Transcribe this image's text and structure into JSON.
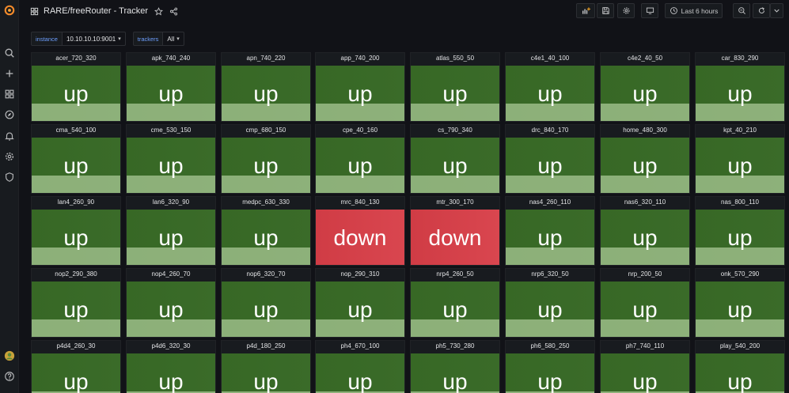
{
  "header": {
    "title": "RARE/freeRouter - Tracker",
    "time_range": "Last 6 hours"
  },
  "variables": [
    {
      "label": "instance",
      "value": "10.10.10.10:9001"
    },
    {
      "label": "trackers",
      "value": "All"
    }
  ],
  "colors": {
    "up": "#376825",
    "down": "#d03c45",
    "background": "#111217",
    "panel": "#181b1f",
    "accent": "#6e9fff"
  },
  "icons": {
    "sidebar": [
      "grafana-logo-icon",
      "search-icon",
      "plus-icon",
      "dashboards-icon",
      "explore-icon",
      "alerting-icon",
      "gear-icon",
      "shield-icon",
      "avatar-icon",
      "help-icon"
    ],
    "toolbar": [
      "add-panel-icon",
      "save-icon",
      "settings-icon",
      "tv-icon",
      "clock-icon",
      "zoom-out-icon",
      "refresh-icon",
      "chevron-down-icon"
    ]
  },
  "panels": [
    {
      "title": "acer_720_320",
      "value": "up"
    },
    {
      "title": "apk_740_240",
      "value": "up"
    },
    {
      "title": "apn_740_220",
      "value": "up"
    },
    {
      "title": "app_740_200",
      "value": "up"
    },
    {
      "title": "atlas_550_50",
      "value": "up"
    },
    {
      "title": "c4e1_40_100",
      "value": "up"
    },
    {
      "title": "c4e2_40_50",
      "value": "up"
    },
    {
      "title": "car_830_290",
      "value": "up"
    },
    {
      "title": "cma_540_100",
      "value": "up"
    },
    {
      "title": "cme_530_150",
      "value": "up"
    },
    {
      "title": "cmp_680_150",
      "value": "up"
    },
    {
      "title": "cpe_40_160",
      "value": "up"
    },
    {
      "title": "cs_790_340",
      "value": "up"
    },
    {
      "title": "drc_840_170",
      "value": "up"
    },
    {
      "title": "home_480_300",
      "value": "up"
    },
    {
      "title": "kpt_40_210",
      "value": "up"
    },
    {
      "title": "lan4_260_90",
      "value": "up"
    },
    {
      "title": "lan6_320_90",
      "value": "up"
    },
    {
      "title": "medpc_630_330",
      "value": "up"
    },
    {
      "title": "mrc_840_130",
      "value": "down"
    },
    {
      "title": "mtr_300_170",
      "value": "down"
    },
    {
      "title": "nas4_260_110",
      "value": "up"
    },
    {
      "title": "nas6_320_110",
      "value": "up"
    },
    {
      "title": "nas_800_110",
      "value": "up"
    },
    {
      "title": "nop2_290_380",
      "value": "up"
    },
    {
      "title": "nop4_260_70",
      "value": "up"
    },
    {
      "title": "nop6_320_70",
      "value": "up"
    },
    {
      "title": "nop_290_310",
      "value": "up"
    },
    {
      "title": "nrp4_260_50",
      "value": "up"
    },
    {
      "title": "nrp6_320_50",
      "value": "up"
    },
    {
      "title": "nrp_200_50",
      "value": "up"
    },
    {
      "title": "onk_570_290",
      "value": "up"
    },
    {
      "title": "p4d4_260_30",
      "value": "up"
    },
    {
      "title": "p4d6_320_30",
      "value": "up"
    },
    {
      "title": "p4d_180_250",
      "value": "up"
    },
    {
      "title": "ph4_670_100",
      "value": "up"
    },
    {
      "title": "ph5_730_280",
      "value": "up"
    },
    {
      "title": "ph6_580_250",
      "value": "up"
    },
    {
      "title": "ph7_740_110",
      "value": "up"
    },
    {
      "title": "play_540_200",
      "value": "up"
    }
  ]
}
